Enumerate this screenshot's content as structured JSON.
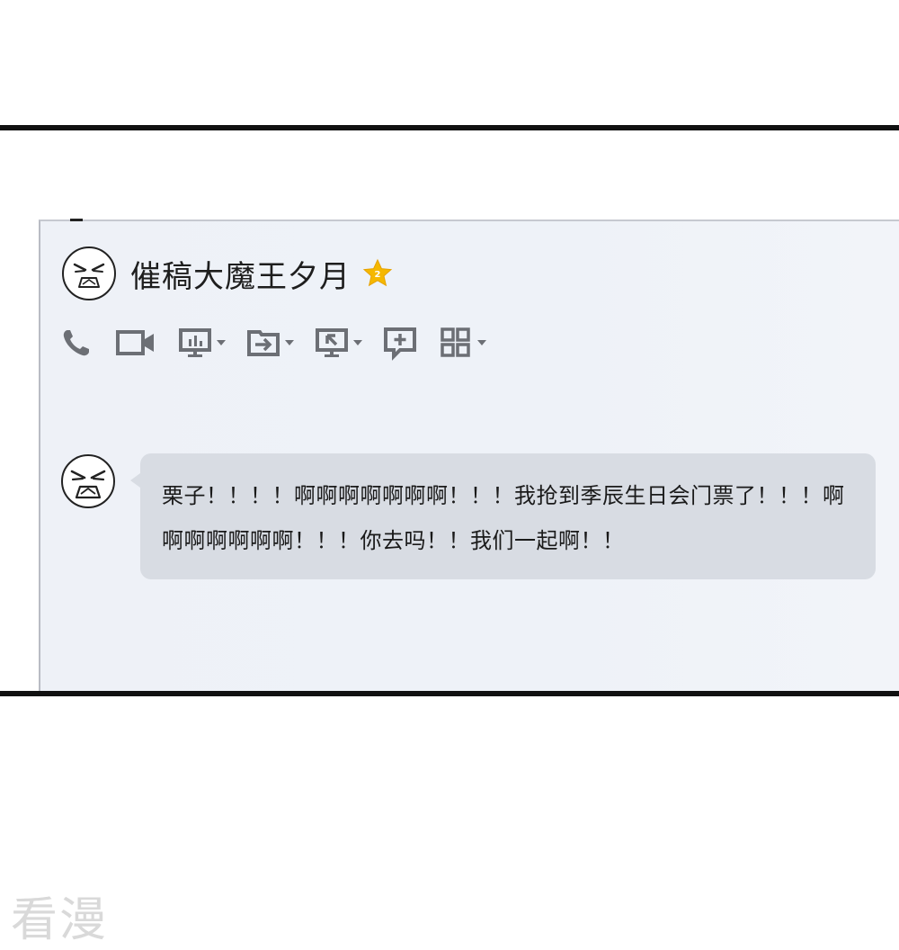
{
  "contact": {
    "name": "催稿大魔王夕月",
    "avatar_icon": "angry-face-icon",
    "badge_icon": "star-badge-icon",
    "badge_color": "#f5b800"
  },
  "toolbar": {
    "items": [
      {
        "name": "voice-call",
        "icon": "phone-icon",
        "has_dropdown": false
      },
      {
        "name": "video-call",
        "icon": "video-camera-icon",
        "has_dropdown": false
      },
      {
        "name": "screen-share",
        "icon": "presentation-icon",
        "has_dropdown": true
      },
      {
        "name": "file-transfer",
        "icon": "folder-send-icon",
        "has_dropdown": true
      },
      {
        "name": "remote-control",
        "icon": "remote-desktop-icon",
        "has_dropdown": true
      },
      {
        "name": "new-discussion",
        "icon": "add-message-icon",
        "has_dropdown": false
      },
      {
        "name": "more-apps",
        "icon": "app-grid-icon",
        "has_dropdown": true
      }
    ]
  },
  "messages": [
    {
      "sender_icon": "angry-face-icon",
      "text": "栗子！！！！啊啊啊啊啊啊啊！！！我抢到季辰生日会门票了！！！啊啊啊啊啊啊啊！！！你去吗！！我们一起啊！！"
    }
  ],
  "watermark": "看漫",
  "colors": {
    "bubble": "#d8dce3",
    "window_bg": "#eef1f7",
    "icon_gray": "#6c6f75",
    "frame": "#111111"
  }
}
